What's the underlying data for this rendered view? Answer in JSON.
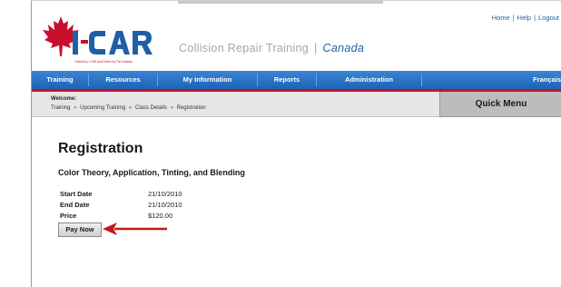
{
  "top_links": {
    "home": "Home",
    "help": "Help",
    "logout": "Logout",
    "separator": "|"
  },
  "brand": {
    "logo_text": "I-CAR",
    "logo_subtext": "Owned by I-CAR and Driven by The Industry",
    "tagline": "Collision Repair Training",
    "tagline_separator": "|",
    "country": "Canada",
    "colors": {
      "maple_red": "#c8102e",
      "brand_blue": "#1f5fa8"
    }
  },
  "nav": {
    "items": [
      {
        "label": "Training"
      },
      {
        "label": "Resources"
      },
      {
        "label": "My Information"
      },
      {
        "label": "Reports"
      },
      {
        "label": "Administration"
      },
      {
        "label": "Français"
      }
    ]
  },
  "info_bar": {
    "welcome": "Welcome:",
    "breadcrumb": [
      "Training",
      "Upcoming Training",
      "Class Details",
      "Registration"
    ],
    "breadcrumb_separator": "»",
    "quick_menu": "Quick Menu"
  },
  "main": {
    "title": "Registration",
    "course": "Color Theory, Application, Tinting, and Blending",
    "details": [
      {
        "label": "Start Date",
        "value": "21/10/2010"
      },
      {
        "label": "End Date",
        "value": "21/10/2010"
      },
      {
        "label": "Price",
        "value": "$120.00"
      }
    ],
    "pay_button": "Pay Now"
  },
  "annotation": {
    "arrow_icon": "red-arrow-left-icon",
    "color": "#c0181e"
  }
}
